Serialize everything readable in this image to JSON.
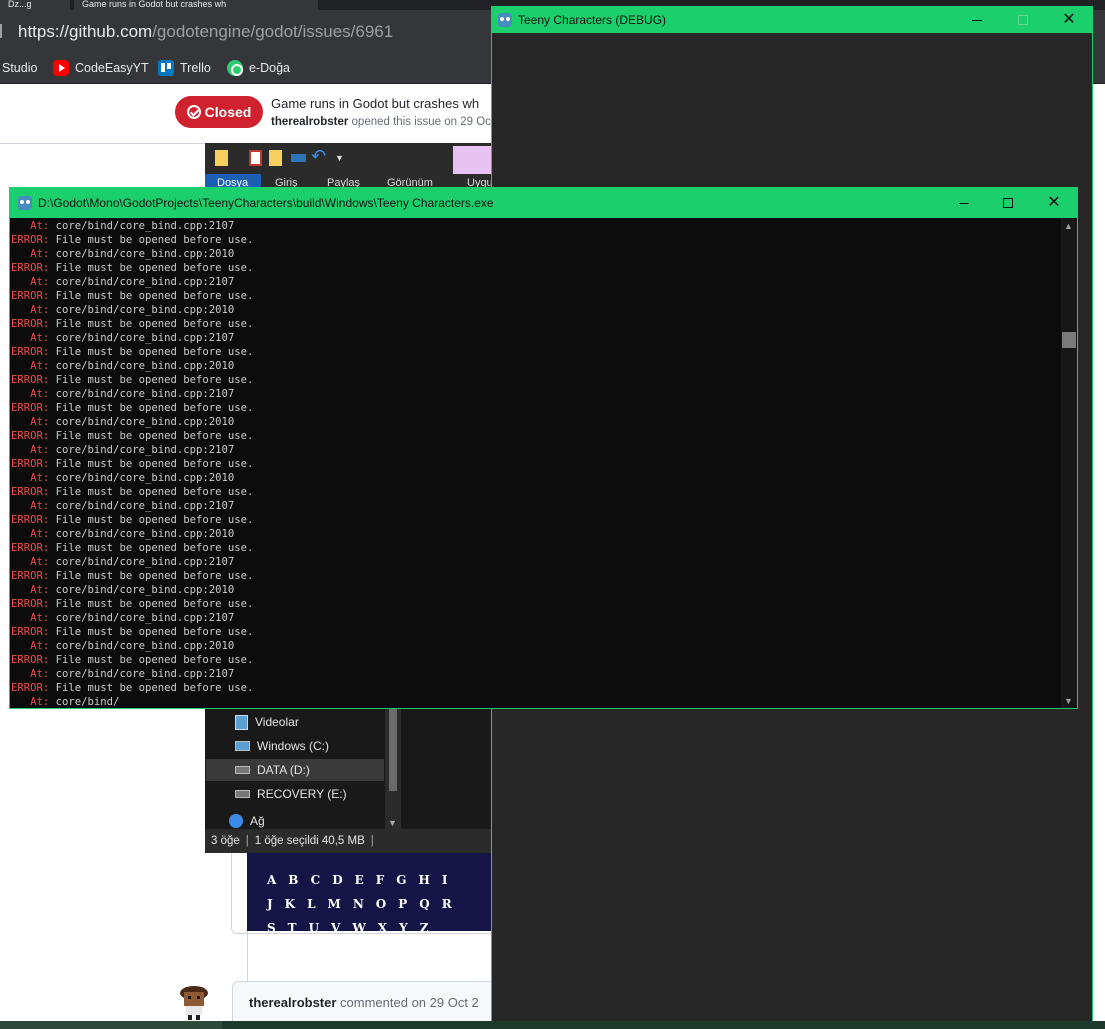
{
  "browser": {
    "tabs": [
      {
        "label": "Dz...g",
        "active": false
      },
      {
        "label": "Game runs in Godot but crashes wh",
        "active": true
      }
    ],
    "url_host": "https://github.com",
    "url_path": "/godotengine/godot/issues/6961",
    "bookmarks": [
      {
        "label": "Studio",
        "icon": "none"
      },
      {
        "label": "CodeEasyYT",
        "icon": "youtube-icon"
      },
      {
        "label": "Trello",
        "icon": "trello-icon"
      },
      {
        "label": "e-Doğa",
        "icon": "edoga-icon"
      }
    ]
  },
  "issue": {
    "status": "Closed",
    "status_color": "#cf222e",
    "title": "Game runs in Godot but crashes wh",
    "author": "therealrobster",
    "meta_rest": " opened this issue on 29 Oc",
    "comment_author": "therealrobster",
    "comment_meta": " commented on 29 Oct 2",
    "font_preview_rows": [
      "ABCDEFGHI",
      "JKLMNOPQR",
      "STUVWXYZ"
    ]
  },
  "explorer": {
    "ribbon_tabs": [
      "Dosya",
      "Giriş",
      "Paylaş",
      "Görünüm",
      "Uygu"
    ],
    "nav_items": [
      {
        "label": "Videolar",
        "icon": "videos-icon",
        "selected": false
      },
      {
        "label": "Windows (C:)",
        "icon": "windows-drive-icon",
        "selected": false
      },
      {
        "label": "DATA (D:)",
        "icon": "drive-icon",
        "selected": true
      },
      {
        "label": "RECOVERY (E:)",
        "icon": "drive-icon",
        "selected": false
      },
      {
        "label": "Ağ",
        "icon": "network-icon",
        "selected": false
      }
    ],
    "status_items": "3 öğe",
    "status_selected": "1 öğe seçildi  40,5 MB"
  },
  "game_window": {
    "title": "Teeny Characters (DEBUG)",
    "accent": "#1bcf6c"
  },
  "console": {
    "title": "D:\\Godot\\Mono\\GodotProjects\\TeenyCharacters\\build\\Windows\\Teeny Characters.exe",
    "lines": [
      {
        "label": "   At:",
        "text": " core/bind/core_bind.cpp:2107"
      },
      {
        "label": "ERROR:",
        "text": " File must be opened before use."
      },
      {
        "label": "   At:",
        "text": " core/bind/core_bind.cpp:2010"
      },
      {
        "label": "ERROR:",
        "text": " File must be opened before use."
      },
      {
        "label": "   At:",
        "text": " core/bind/core_bind.cpp:2107"
      },
      {
        "label": "ERROR:",
        "text": " File must be opened before use."
      },
      {
        "label": "   At:",
        "text": " core/bind/core_bind.cpp:2010"
      },
      {
        "label": "ERROR:",
        "text": " File must be opened before use."
      },
      {
        "label": "   At:",
        "text": " core/bind/core_bind.cpp:2107"
      },
      {
        "label": "ERROR:",
        "text": " File must be opened before use."
      },
      {
        "label": "   At:",
        "text": " core/bind/core_bind.cpp:2010"
      },
      {
        "label": "ERROR:",
        "text": " File must be opened before use."
      },
      {
        "label": "   At:",
        "text": " core/bind/core_bind.cpp:2107"
      },
      {
        "label": "ERROR:",
        "text": " File must be opened before use."
      },
      {
        "label": "   At:",
        "text": " core/bind/core_bind.cpp:2010"
      },
      {
        "label": "ERROR:",
        "text": " File must be opened before use."
      },
      {
        "label": "   At:",
        "text": " core/bind/core_bind.cpp:2107"
      },
      {
        "label": "ERROR:",
        "text": " File must be opened before use."
      },
      {
        "label": "   At:",
        "text": " core/bind/core_bind.cpp:2010"
      },
      {
        "label": "ERROR:",
        "text": " File must be opened before use."
      },
      {
        "label": "   At:",
        "text": " core/bind/core_bind.cpp:2107"
      },
      {
        "label": "ERROR:",
        "text": " File must be opened before use."
      },
      {
        "label": "   At:",
        "text": " core/bind/core_bind.cpp:2010"
      },
      {
        "label": "ERROR:",
        "text": " File must be opened before use."
      },
      {
        "label": "   At:",
        "text": " core/bind/core_bind.cpp:2107"
      },
      {
        "label": "ERROR:",
        "text": " File must be opened before use."
      },
      {
        "label": "   At:",
        "text": " core/bind/core_bind.cpp:2010"
      },
      {
        "label": "ERROR:",
        "text": " File must be opened before use."
      },
      {
        "label": "   At:",
        "text": " core/bind/core_bind.cpp:2107"
      },
      {
        "label": "ERROR:",
        "text": " File must be opened before use."
      },
      {
        "label": "   At:",
        "text": " core/bind/core_bind.cpp:2010"
      },
      {
        "label": "ERROR:",
        "text": " File must be opened before use."
      },
      {
        "label": "   At:",
        "text": " core/bind/core_bind.cpp:2107"
      },
      {
        "label": "ERROR:",
        "text": " File must be opened before use."
      },
      {
        "label": "   At:",
        "text": " core/bind/"
      }
    ]
  }
}
